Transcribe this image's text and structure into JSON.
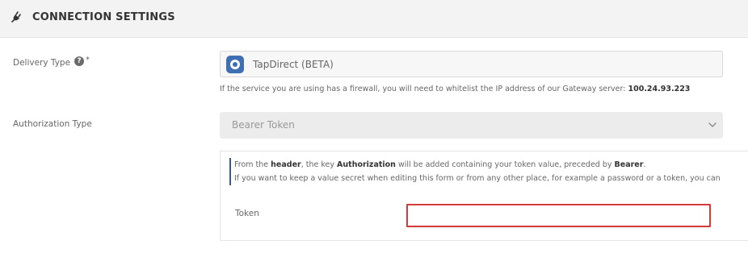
{
  "header": {
    "title": "CONNECTION SETTINGS",
    "icon": "plug-icon"
  },
  "delivery": {
    "label": "Delivery Type",
    "help_icon": "?",
    "required": "*",
    "value": "TapDirect (BETA)",
    "icon": "tapdirect-icon",
    "icon_color": "#3e6fb2"
  },
  "firewall_note": {
    "text": "If the service you are using has a firewall, you will need to whitelist the IP address of our Gateway server: ",
    "ip": "100.24.93.223"
  },
  "auth": {
    "label": "Authorization Type",
    "value": "Bearer Token"
  },
  "info": {
    "line1_a": "From the ",
    "line1_b": "header",
    "line1_c": ", the key ",
    "line1_d": "Authorization",
    "line1_e": " will be added containing your token value, preceded by ",
    "line1_f": "Bearer",
    "line1_g": ".",
    "line2": "If you want to keep a value secret when editing this form or from any other place, for example a password or a token, you can"
  },
  "token": {
    "label": "Token",
    "value": "",
    "highlight_color": "#d63b3b"
  }
}
